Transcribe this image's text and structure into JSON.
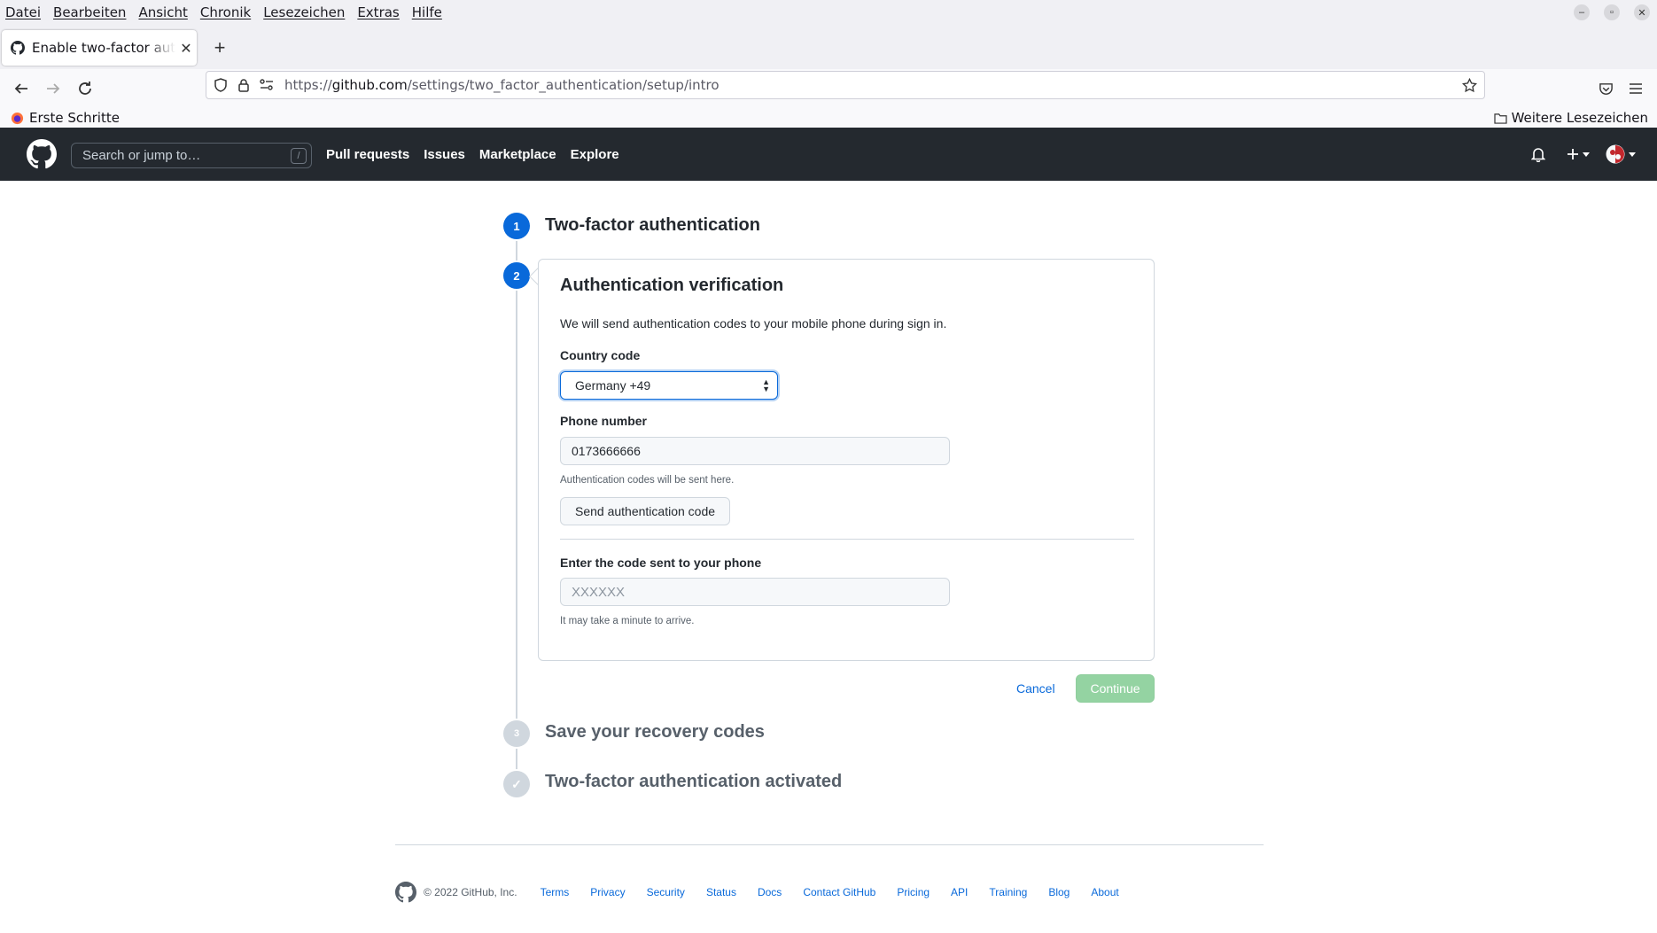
{
  "browser": {
    "menu": [
      "Datei",
      "Bearbeiten",
      "Ansicht",
      "Chronik",
      "Lesezeichen",
      "Extras",
      "Hilfe"
    ],
    "tab_title": "Enable two-factor authentication",
    "url_prefix": "https://",
    "url_domain": "github.com",
    "url_path": "/settings/two_factor_authentication/setup/intro",
    "bookmark_left": "Erste Schritte",
    "bookmark_right": "Weitere Lesezeichen"
  },
  "header": {
    "search_placeholder": "Search or jump to…",
    "search_shortcut": "/",
    "nav": [
      "Pull requests",
      "Issues",
      "Marketplace",
      "Explore"
    ]
  },
  "steps": [
    {
      "num": "1",
      "title": "Two-factor authentication"
    },
    {
      "num": "2",
      "title": "Authentication verification"
    },
    {
      "num": "3",
      "title": "Save your recovery codes"
    },
    {
      "num": "✓",
      "title": "Two-factor authentication activated"
    }
  ],
  "form": {
    "lead": "We will send authentication codes to your mobile phone during sign in.",
    "country_label": "Country code",
    "country_value": "Germany +49",
    "phone_label": "Phone number",
    "phone_value": "0173666666",
    "phone_note": "Authentication codes will be sent here.",
    "send_button": "Send authentication code",
    "code_label": "Enter the code sent to your phone",
    "code_placeholder": "XXXXXX",
    "code_note": "It may take a minute to arrive."
  },
  "actions": {
    "cancel": "Cancel",
    "continue": "Continue"
  },
  "footer": {
    "copyright": "© 2022 GitHub, Inc.",
    "links": [
      "Terms",
      "Privacy",
      "Security",
      "Status",
      "Docs",
      "Contact GitHub",
      "Pricing",
      "API",
      "Training",
      "Blog",
      "About"
    ]
  },
  "colors": {
    "accent": "#0969da",
    "header_bg": "#24292f",
    "continue_disabled": "#94d3a2"
  }
}
